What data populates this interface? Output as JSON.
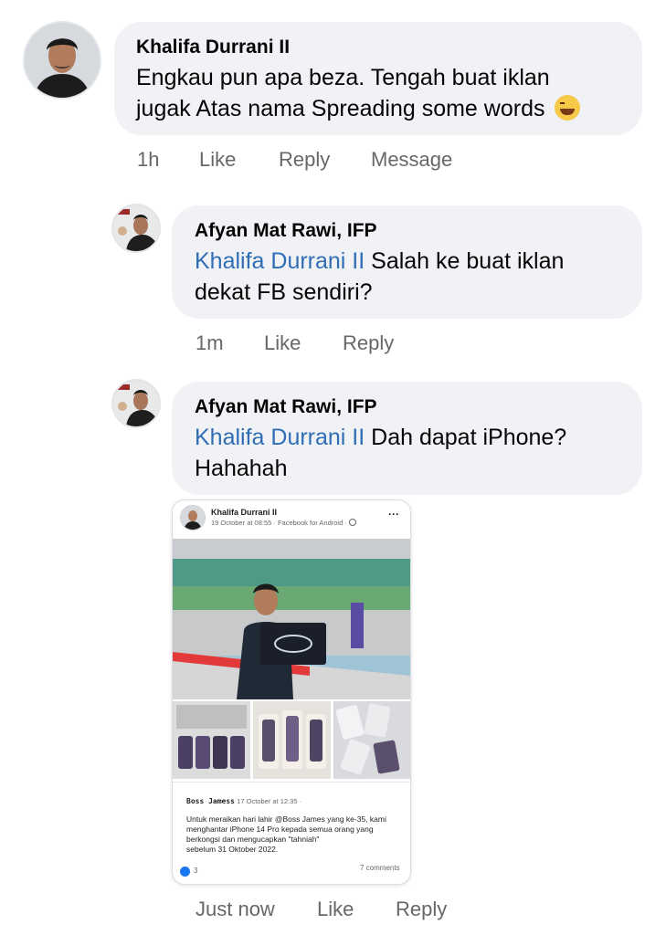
{
  "comments": [
    {
      "author": "Khalifa Durrani II",
      "text_line1": "Engkau pun apa beza. Tengah buat iklan",
      "text_line2": "jugak Atas nama Spreading some words",
      "emoji": "laughing-tears-emoji",
      "time": "1h",
      "like": "Like",
      "reply": "Reply",
      "message": "Message"
    },
    {
      "author": "Afyan Mat Rawi, IFP",
      "mention": "Khalifa Durrani II",
      "text_line1": " Salah ke buat iklan",
      "text_line2": "dekat FB sendiri?",
      "time": "1m",
      "like": "Like",
      "reply": "Reply"
    },
    {
      "author": "Afyan Mat Rawi, IFP",
      "mention": "Khalifa Durrani II",
      "text_line1": " Dah dapat iPhone?",
      "text_line2": "Hahahah",
      "time": "Just now",
      "like": "Like",
      "reply": "Reply"
    }
  ],
  "attachment": {
    "author": "Khalifa Durrani II",
    "meta": "19 October at 08:55 · Facebook for Android ·",
    "more": "···",
    "shared_author": "Boss Jamess",
    "shared_time": "17 October at 12:35 ·",
    "body_line1": "Untuk meraikan hari lahir @Boss James yang ke-35, kami",
    "body_line2": "menghantar iPhone 14 Pro kepada semua orang yang",
    "body_line3": "berkongsi dan mengucapkan \"tahniah\"",
    "body_line4": "sebelum 31 Oktober 2022.",
    "reaction_count": "3",
    "comments_count": "7 comments"
  },
  "colors": {
    "bubble": "#f0f2f5",
    "mention": "#2f6db5",
    "meta": "#65676b",
    "like_icon": "#1877f2"
  }
}
